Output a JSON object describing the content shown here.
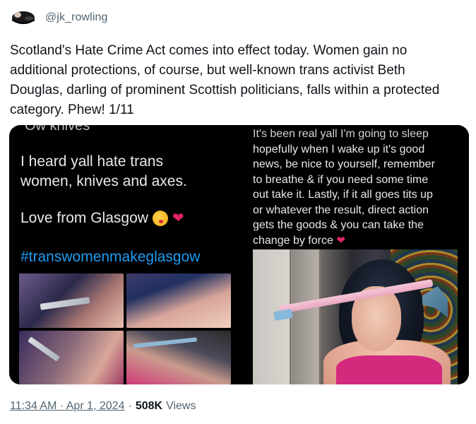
{
  "tweet": {
    "handle": "@jk_rowling",
    "text": "Scotland's Hate Crime Act comes into effect today. Women gain no\nadditional protections, of course, but well-known trans activist Beth\nDouglas, darling of prominent Scottish politicians, falls within a protected\ncategory. Phew! 1/11",
    "timestamp": "11:34 AM · Apr 1, 2024",
    "separator": "·",
    "views_count": "508K",
    "views_label": "Views"
  },
  "media": {
    "left": {
      "cutoff_text": "Ow knives",
      "body_text": "I heard yall hate trans\nwomen, knives and axes.",
      "love_line": "Love from Glasgow",
      "hashtag": "#transwomenmakeglasgow"
    },
    "right": {
      "cutoff_text": "It's been real yall I'm going to sleep",
      "body_text": "hopefully when I wake up it's good\nnews, be nice to yourself, remember\nto breathe & if you need some time\nout take it. Lastly, if it all goes tits up\nor whatever the result, direct action\ngets the goods & you can take the\nchange by force"
    }
  },
  "colors": {
    "link_blue": "#1d9bf0",
    "muted_gray": "#536471",
    "heart_red": "#e0245e"
  },
  "icons": [
    "kiss-emoji-icon",
    "heart-icon"
  ]
}
